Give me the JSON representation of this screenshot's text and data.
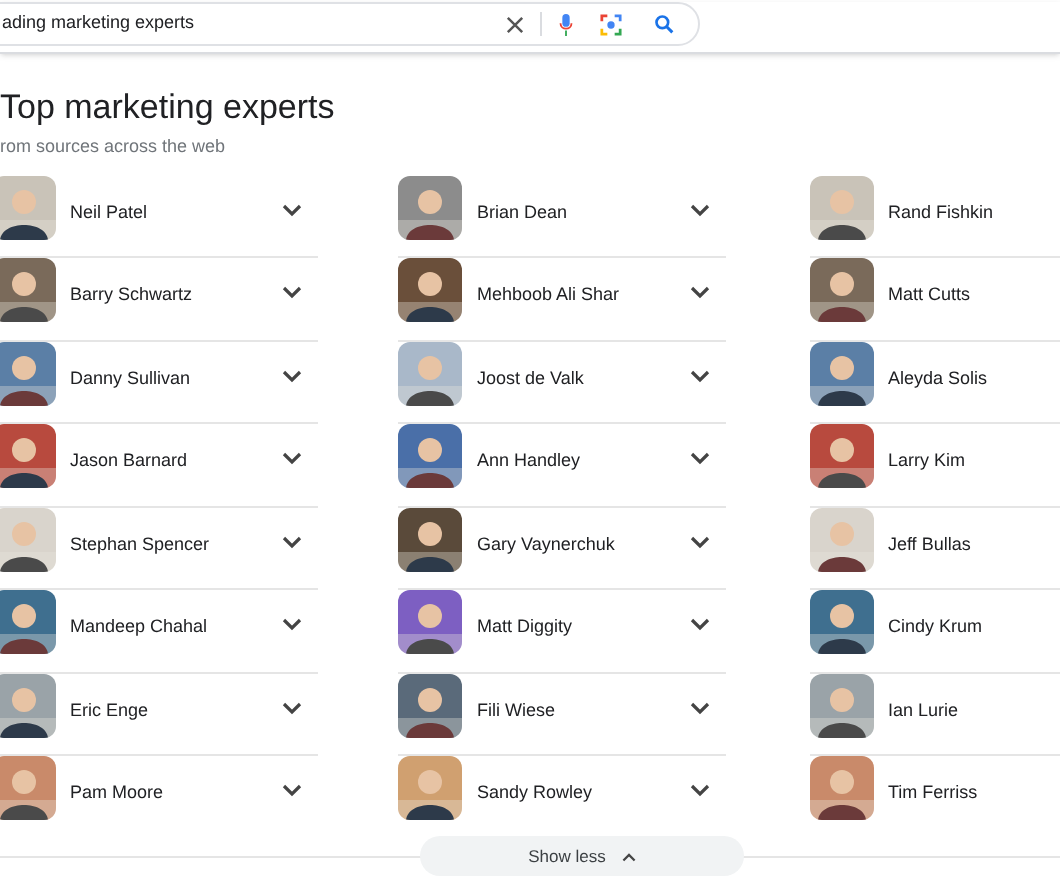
{
  "search": {
    "value": "ading marketing experts"
  },
  "section": {
    "title": "Top marketing experts",
    "subtitle": "rom sources across the web"
  },
  "columns": [
    {
      "people": [
        {
          "name": "Neil Patel"
        },
        {
          "name": "Barry Schwartz"
        },
        {
          "name": "Danny Sullivan"
        },
        {
          "name": "Jason Barnard"
        },
        {
          "name": "Stephan Spencer"
        },
        {
          "name": "Mandeep Chahal"
        },
        {
          "name": "Eric Enge"
        },
        {
          "name": "Pam Moore"
        }
      ]
    },
    {
      "people": [
        {
          "name": "Brian Dean"
        },
        {
          "name": "Mehboob Ali Shar"
        },
        {
          "name": "Joost de Valk"
        },
        {
          "name": "Ann Handley"
        },
        {
          "name": "Gary Vaynerchuk"
        },
        {
          "name": "Matt Diggity"
        },
        {
          "name": "Fili Wiese"
        },
        {
          "name": "Sandy Rowley"
        }
      ]
    },
    {
      "people": [
        {
          "name": "Rand Fishkin"
        },
        {
          "name": "Matt Cutts"
        },
        {
          "name": "Aleyda Solis"
        },
        {
          "name": "Larry Kim"
        },
        {
          "name": "Jeff Bullas"
        },
        {
          "name": "Cindy Krum"
        },
        {
          "name": "Ian Lurie"
        },
        {
          "name": "Tim Ferriss"
        }
      ]
    }
  ],
  "toggle": {
    "label": "Show less"
  }
}
